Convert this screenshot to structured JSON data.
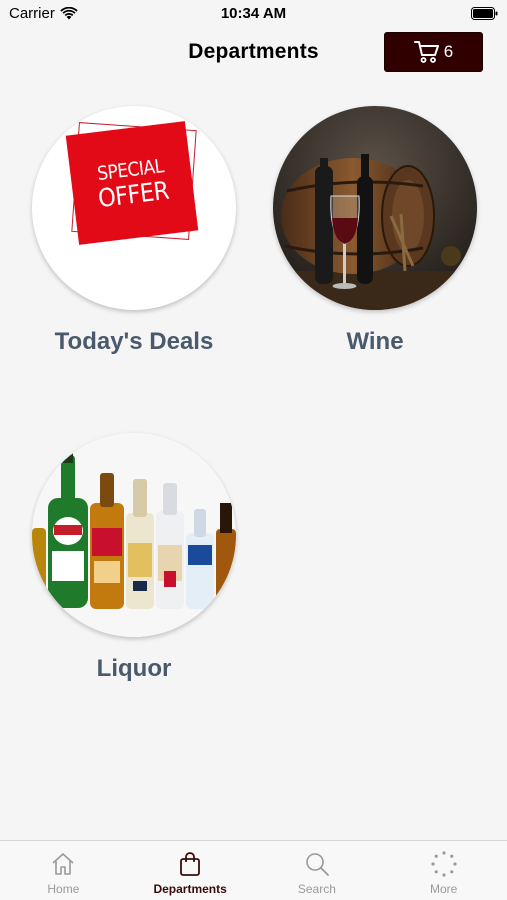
{
  "status_bar": {
    "carrier": "Carrier",
    "time": "10:34 AM"
  },
  "nav": {
    "title": "Departments",
    "cart_count": "6"
  },
  "departments": [
    {
      "label": "Today's Deals",
      "image_text": [
        "SPECIAL",
        "OFFER"
      ]
    },
    {
      "label": "Wine"
    },
    {
      "label": "Liquor"
    }
  ],
  "tab_bar": {
    "items": [
      {
        "label": "Home",
        "icon": "home-icon"
      },
      {
        "label": "Departments",
        "icon": "shopping-bag-icon",
        "active": true
      },
      {
        "label": "Search",
        "icon": "search-icon"
      },
      {
        "label": "More",
        "icon": "more-dots-icon"
      }
    ]
  },
  "colors": {
    "cart_bg": "#300000",
    "label": "#4a5a6c",
    "active_tab": "#3a0a0a",
    "offer_red": "#e30a17"
  }
}
